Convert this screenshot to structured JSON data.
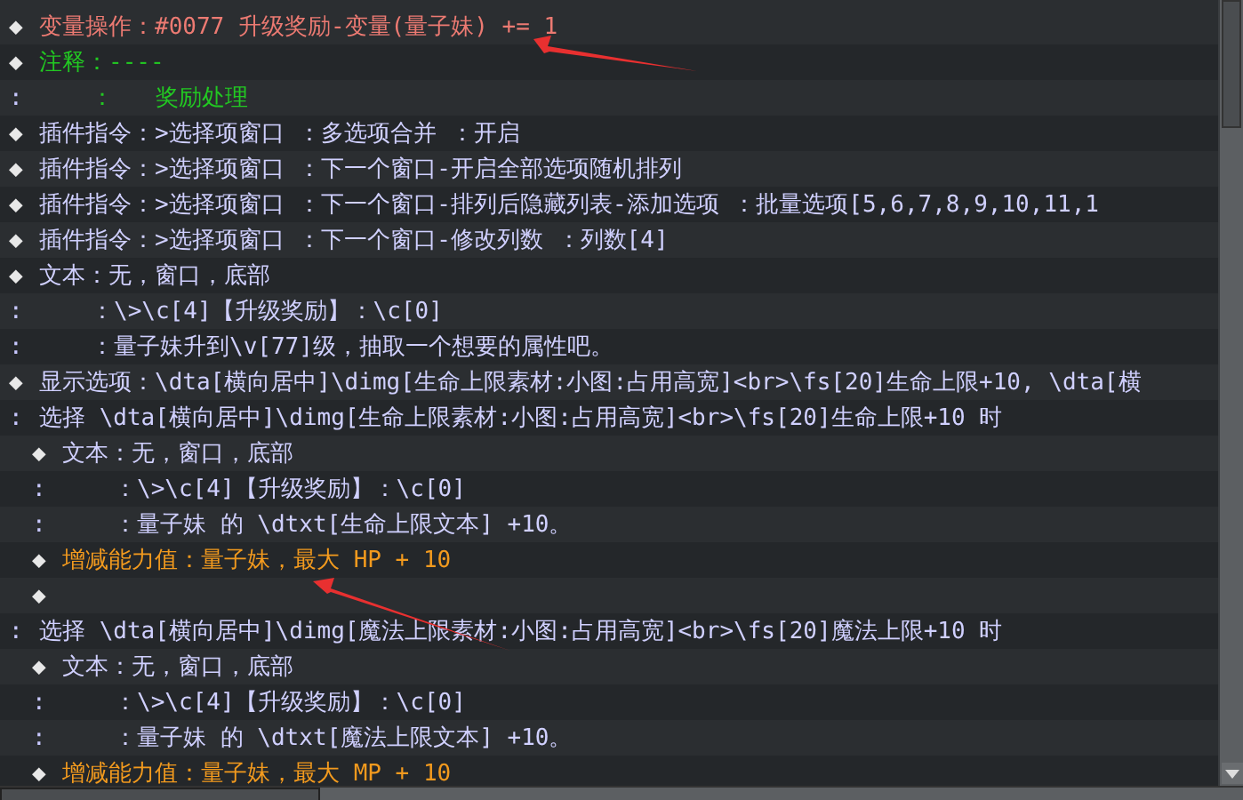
{
  "rows": [
    {
      "kind": "variable",
      "marker": "◆",
      "text": "变量操作：#0077 升级奖励-变量(量子妹) += 1"
    },
    {
      "kind": "comment",
      "marker": "◆",
      "text": "注释：----"
    },
    {
      "kind": "comment-cont",
      "marker": ":",
      "text": "：   奖励处理"
    },
    {
      "kind": "plugin",
      "marker": "◆",
      "text": "插件指令：>选择项窗口 ：多选项合并 ：开启"
    },
    {
      "kind": "plugin",
      "marker": "◆",
      "text": "插件指令：>选择项窗口 ：下一个窗口-开启全部选项随机排列"
    },
    {
      "kind": "plugin",
      "marker": "◆",
      "text": "插件指令：>选择项窗口 ：下一个窗口-排列后隐藏列表-添加选项 ：批量选项[5,6,7,8,9,10,11,1"
    },
    {
      "kind": "plugin",
      "marker": "◆",
      "text": "插件指令：>选择项窗口 ：下一个窗口-修改列数 ：列数[4]"
    },
    {
      "kind": "plugin",
      "marker": "◆",
      "text": "文本：无，窗口，底部"
    },
    {
      "kind": "cont",
      "marker": ":",
      "text": "：\\>\\c[4]【升级奖励】：\\c[0]"
    },
    {
      "kind": "cont",
      "marker": ":",
      "text": "：量子妹升到\\v[77]级，抽取一个想要的属性吧。"
    },
    {
      "kind": "plugin",
      "marker": "◆",
      "text": "显示选项：\\dta[横向居中]\\dimg[生命上限素材:小图:占用高宽]<br>\\fs[20]生命上限+10, \\dta[横"
    },
    {
      "kind": "branch",
      "marker": ":",
      "text": "选择 \\dta[横向居中]\\dimg[生命上限素材:小图:占用高宽]<br>\\fs[20]生命上限+10 时",
      "children": [
        {
          "kind": "plugin",
          "marker": "◆",
          "text": "文本：无，窗口，底部"
        },
        {
          "kind": "cont",
          "marker": ":",
          "text": "：\\>\\c[4]【升级奖励】：\\c[0]"
        },
        {
          "kind": "cont",
          "marker": ":",
          "text": "：量子妹 的 \\dtxt[生命上限文本] +10。"
        },
        {
          "kind": "ability",
          "marker": "◆",
          "text": "增减能力值：量子妹，最大 HP + 10"
        },
        {
          "kind": "plugin",
          "marker": "◆"
        }
      ]
    },
    {
      "kind": "branch",
      "marker": ":",
      "text": "选择 \\dta[横向居中]\\dimg[魔法上限素材:小图:占用高宽]<br>\\fs[20]魔法上限+10 时",
      "children": [
        {
          "kind": "plugin",
          "marker": "◆",
          "text": "文本：无，窗口，底部"
        },
        {
          "kind": "cont",
          "marker": ":",
          "text": "：\\>\\c[4]【升级奖励】：\\c[0]"
        },
        {
          "kind": "cont",
          "marker": ":",
          "text": "：量子妹 的 \\dtxt[魔法上限文本] +10。"
        },
        {
          "kind": "ability",
          "marker": "◆",
          "text": "增减能力值：量子妹，最大 MP + 10"
        }
      ]
    }
  ]
}
